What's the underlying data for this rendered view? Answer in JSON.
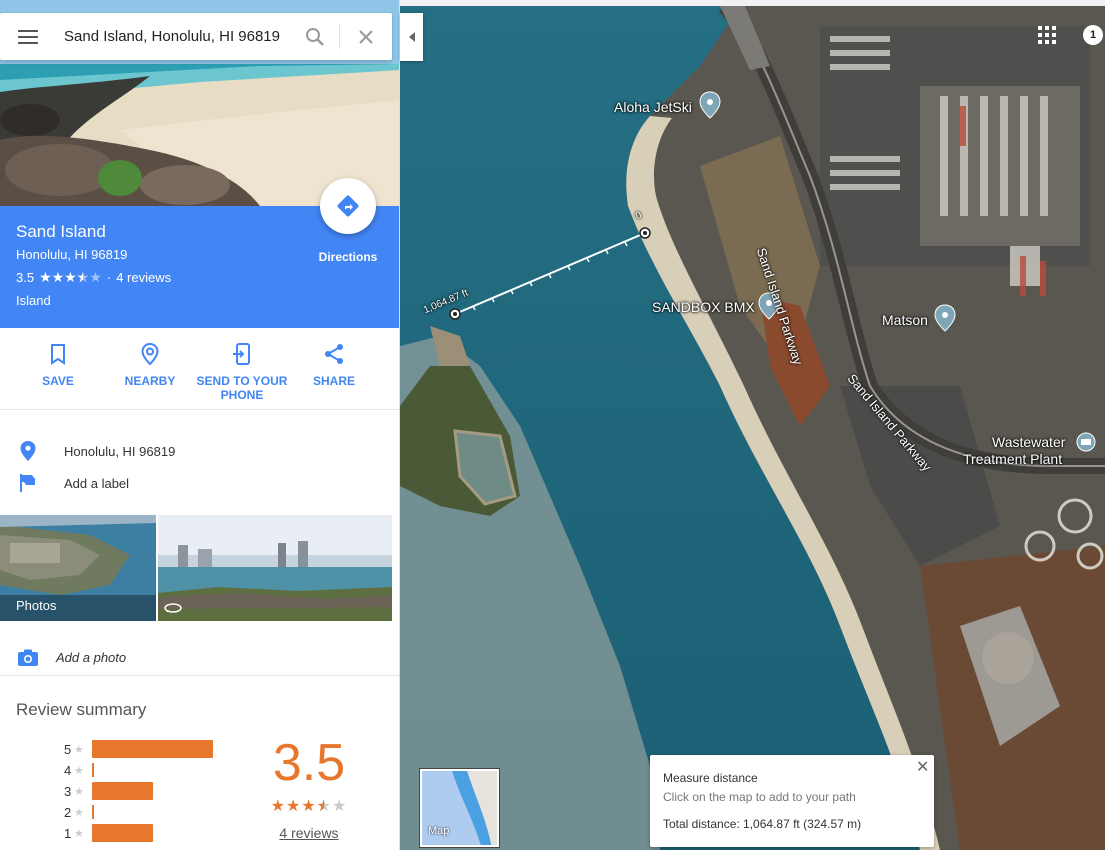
{
  "search": {
    "query": "Sand Island, Honolulu, HI 96819"
  },
  "place": {
    "name": "Sand Island",
    "address": "Honolulu, HI 96819",
    "rating": "3.5",
    "reviews_link": "4 reviews",
    "type": "Island",
    "directions_label": "Directions"
  },
  "actions": [
    {
      "label": "SAVE"
    },
    {
      "label": "NEARBY"
    },
    {
      "label": "SEND TO YOUR PHONE"
    },
    {
      "label": "SHARE"
    }
  ],
  "details": {
    "address": "Honolulu, HI 96819",
    "add_label": "Add a label"
  },
  "photos": {
    "label": "Photos"
  },
  "add_photo": "Add a photo",
  "review_summary": {
    "title": "Review summary",
    "score": "3.5",
    "stars": 3.5,
    "reviews_link": "4 reviews",
    "bars": [
      {
        "star": "5",
        "fraction": 1.0
      },
      {
        "star": "4",
        "fraction": 0.0
      },
      {
        "star": "3",
        "fraction": 0.5
      },
      {
        "star": "2",
        "fraction": 0.0
      },
      {
        "star": "1",
        "fraction": 0.5
      }
    ]
  },
  "map": {
    "labels": {
      "aloha": "Aloha JetSki",
      "sandbox": "SANDBOX BMX",
      "matson": "Matson",
      "wastewater_1": "Wastewater",
      "wastewater_2": "Treatment Plant",
      "road_1": "Sand Island Parkway",
      "road_2": "Sand Island Parkway",
      "dist_marker": "1,064.87 ft",
      "zero_marker": "0"
    },
    "notifications": "1",
    "minimap_label": "Map"
  },
  "measure": {
    "title": "Measure distance",
    "subtitle": "Click on the map to add to your path",
    "total": "Total distance: 1,064.87 ft (324.57 m)"
  },
  "colors": {
    "accent": "#4285f4",
    "rating": "#e8772e"
  }
}
